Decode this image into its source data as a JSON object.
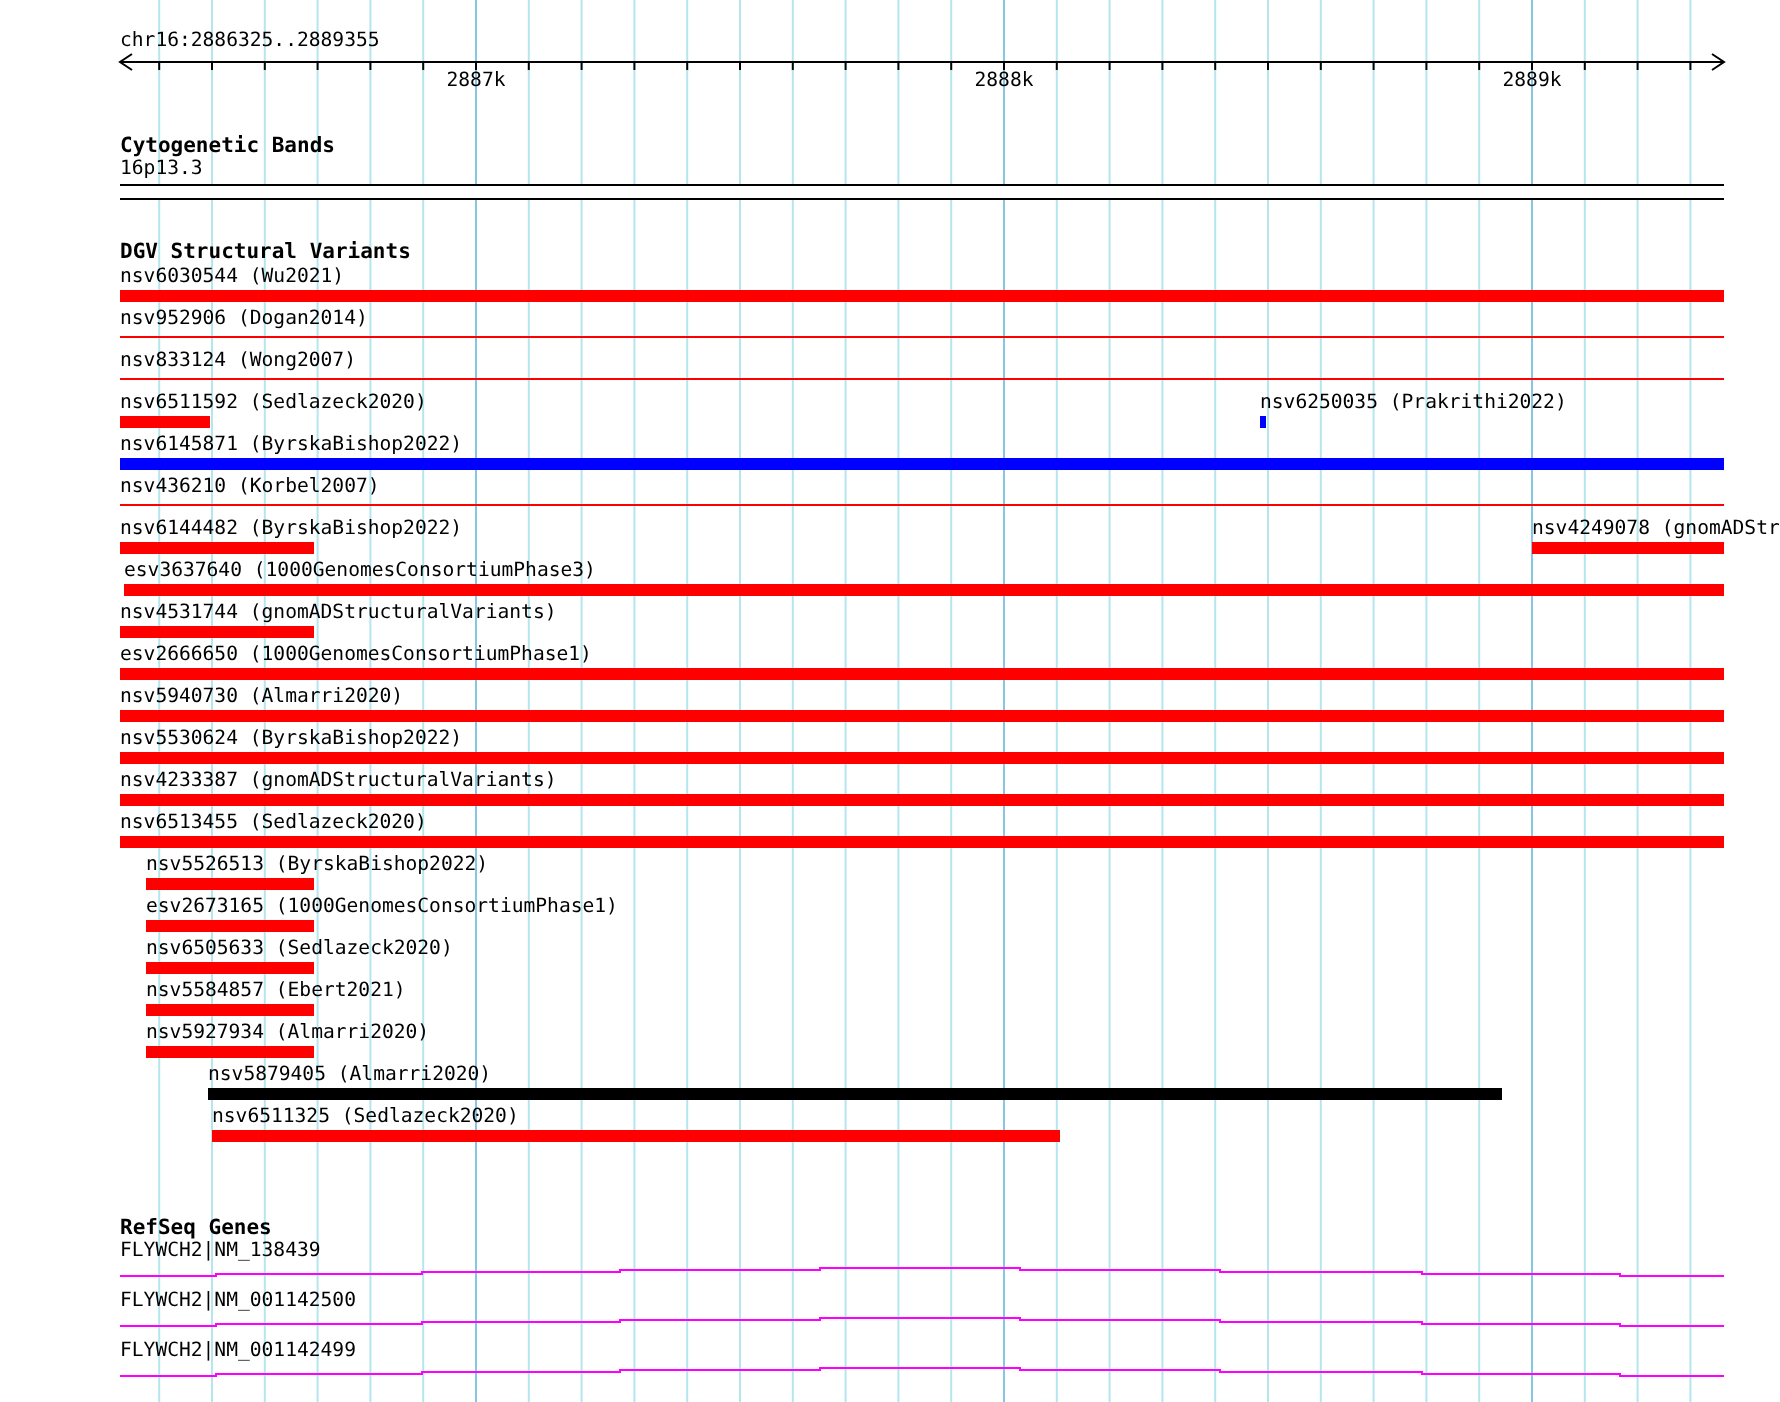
{
  "ruler": {
    "location": "chr16:2886325..2889355",
    "ticks": [
      "2887k",
      "2888k",
      "2889k"
    ]
  },
  "cytogenetic_bands": {
    "title": "Cytogenetic Bands",
    "bands": [
      {
        "label": "16p13.3"
      }
    ]
  },
  "structural_variants": {
    "title": "DGV Structural Variants",
    "rows": [
      {
        "features": [
          {
            "label": "nsv6030544 (Wu2021)",
            "color": "#ff0000",
            "kind": "bar"
          }
        ]
      },
      {
        "features": [
          {
            "label": "nsv952906 (Dogan2014)",
            "color": "#ff0000",
            "kind": "line"
          }
        ]
      },
      {
        "features": [
          {
            "label": "nsv833124 (Wong2007)",
            "color": "#ff0000",
            "kind": "line"
          }
        ]
      },
      {
        "features": [
          {
            "label": "nsv6511592 (Sedlazeck2020)",
            "color": "#ff0000",
            "kind": "bar"
          },
          {
            "label": "nsv6250035 (Prakrithi2022)",
            "color": "#0000ff",
            "kind": "bar"
          }
        ]
      },
      {
        "features": [
          {
            "label": "nsv6145871 (ByrskaBishop2022)",
            "color": "#0000ff",
            "kind": "bar"
          }
        ]
      },
      {
        "features": [
          {
            "label": "nsv436210 (Korbel2007)",
            "color": "#ff0000",
            "kind": "line"
          }
        ]
      },
      {
        "features": [
          {
            "label": "nsv6144482 (ByrskaBishop2022)",
            "color": "#ff0000",
            "kind": "bar"
          },
          {
            "label": "nsv4249078 (gnomADStr",
            "color": "#ff0000",
            "kind": "bar"
          }
        ]
      },
      {
        "features": [
          {
            "label": "esv3637640 (1000GenomesConsortiumPhase3)",
            "color": "#ff0000",
            "kind": "bar"
          }
        ]
      },
      {
        "features": [
          {
            "label": "nsv4531744 (gnomADStructuralVariants)",
            "color": "#ff0000",
            "kind": "bar"
          }
        ]
      },
      {
        "features": [
          {
            "label": "esv2666650 (1000GenomesConsortiumPhase1)",
            "color": "#ff0000",
            "kind": "bar"
          }
        ]
      },
      {
        "features": [
          {
            "label": "nsv5940730 (Almarri2020)",
            "color": "#ff0000",
            "kind": "bar"
          }
        ]
      },
      {
        "features": [
          {
            "label": "nsv5530624 (ByrskaBishop2022)",
            "color": "#ff0000",
            "kind": "bar"
          }
        ]
      },
      {
        "features": [
          {
            "label": "nsv4233387 (gnomADStructuralVariants)",
            "color": "#ff0000",
            "kind": "bar"
          }
        ]
      },
      {
        "features": [
          {
            "label": "nsv6513455 (Sedlazeck2020)",
            "color": "#ff0000",
            "kind": "bar"
          }
        ]
      },
      {
        "features": [
          {
            "label": "nsv5526513 (ByrskaBishop2022)",
            "color": "#ff0000",
            "kind": "bar"
          }
        ]
      },
      {
        "features": [
          {
            "label": "esv2673165 (1000GenomesConsortiumPhase1)",
            "color": "#ff0000",
            "kind": "bar"
          }
        ]
      },
      {
        "features": [
          {
            "label": "nsv6505633 (Sedlazeck2020)",
            "color": "#ff0000",
            "kind": "bar"
          }
        ]
      },
      {
        "features": [
          {
            "label": "nsv5584857 (Ebert2021)",
            "color": "#ff0000",
            "kind": "bar"
          }
        ]
      },
      {
        "features": [
          {
            "label": "nsv5927934 (Almarri2020)",
            "color": "#ff0000",
            "kind": "bar"
          }
        ]
      },
      {
        "features": [
          {
            "label": "nsv5879405 (Almarri2020)",
            "color": "#000000",
            "kind": "bar"
          }
        ]
      },
      {
        "features": [
          {
            "label": "nsv6511325 (Sedlazeck2020)",
            "color": "#ff0000",
            "kind": "bar"
          }
        ]
      }
    ]
  },
  "refseq_genes": {
    "title": "RefSeq Genes",
    "genes": [
      {
        "label": "FLYWCH2|NM_138439"
      },
      {
        "label": "FLYWCH2|NM_001142500"
      },
      {
        "label": "FLYWCH2|NM_001142499"
      }
    ]
  }
}
